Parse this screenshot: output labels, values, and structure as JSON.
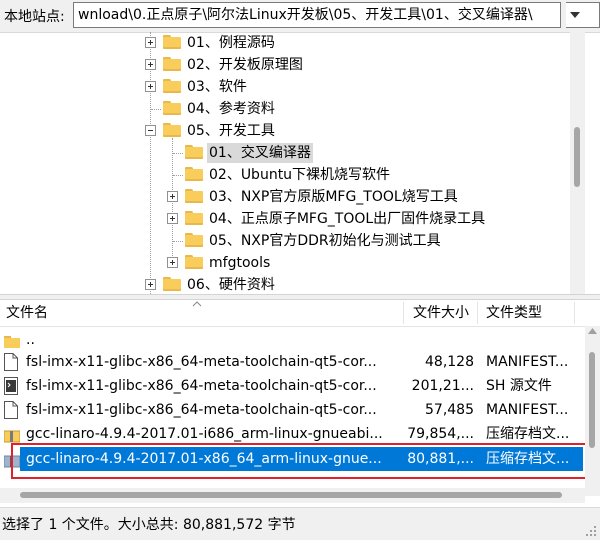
{
  "path_bar": {
    "label": "本地站点:",
    "value": "wnload\\0.正点原子\\阿尔法Linux开发板\\05、开发工具\\01、交叉编译器\\"
  },
  "tree": {
    "items": [
      {
        "label": "01、例程源码",
        "toggle": "plus"
      },
      {
        "label": "02、开发板原理图",
        "toggle": "plus"
      },
      {
        "label": "03、软件",
        "toggle": "plus"
      },
      {
        "label": "04、参考资料",
        "toggle": "none"
      },
      {
        "label": "05、开发工具",
        "toggle": "minus"
      },
      {
        "label": "01、交叉编译器",
        "toggle": "none",
        "selected": true
      },
      {
        "label": "02、Ubuntu下裸机烧写软件",
        "toggle": "none"
      },
      {
        "label": "03、NXP官方原版MFG_TOOL烧写工具",
        "toggle": "plus"
      },
      {
        "label": "04、正点原子MFG_TOOL出厂固件烧录工具",
        "toggle": "plus"
      },
      {
        "label": "05、NXP官方DDR初始化与测试工具",
        "toggle": "none"
      },
      {
        "label": "mfgtools",
        "toggle": "plus"
      },
      {
        "label": "06、硬件资料",
        "toggle": "plus"
      }
    ]
  },
  "list": {
    "columns": {
      "name": "文件名",
      "size": "文件大小",
      "type": "文件类型"
    },
    "rows": [
      {
        "icon": "parent-folder-icon",
        "name": "..",
        "size": "",
        "type": ""
      },
      {
        "icon": "document-icon",
        "name": "fsl-imx-x11-glibc-x86_64-meta-toolchain-qt5-cor...",
        "size": "48,128",
        "type": "MANIFEST..."
      },
      {
        "icon": "shell-script-icon",
        "name": "fsl-imx-x11-glibc-x86_64-meta-toolchain-qt5-cor...",
        "size": "201,21...",
        "type": "SH 源文件"
      },
      {
        "icon": "document-icon",
        "name": "fsl-imx-x11-glibc-x86_64-meta-toolchain-qt5-cor...",
        "size": "57,485",
        "type": "MANIFEST..."
      },
      {
        "icon": "archive-icon",
        "name": "gcc-linaro-4.9.4-2017.01-i686_arm-linux-gnueabi...",
        "size": "79,854,...",
        "type": "压缩存档文..."
      },
      {
        "icon": "archive-icon",
        "name": "gcc-linaro-4.9.4-2017.01-x86_64_arm-linux-gnue...",
        "size": "80,881,...",
        "type": "压缩存档文...",
        "selected": true
      }
    ]
  },
  "status": {
    "text": "选择了 1 个文件。大小总共: 80,881,572 字节"
  },
  "colors": {
    "selection": "#0078d7",
    "highlight_box": "#e0202a",
    "folder": "#f8cd5b"
  }
}
